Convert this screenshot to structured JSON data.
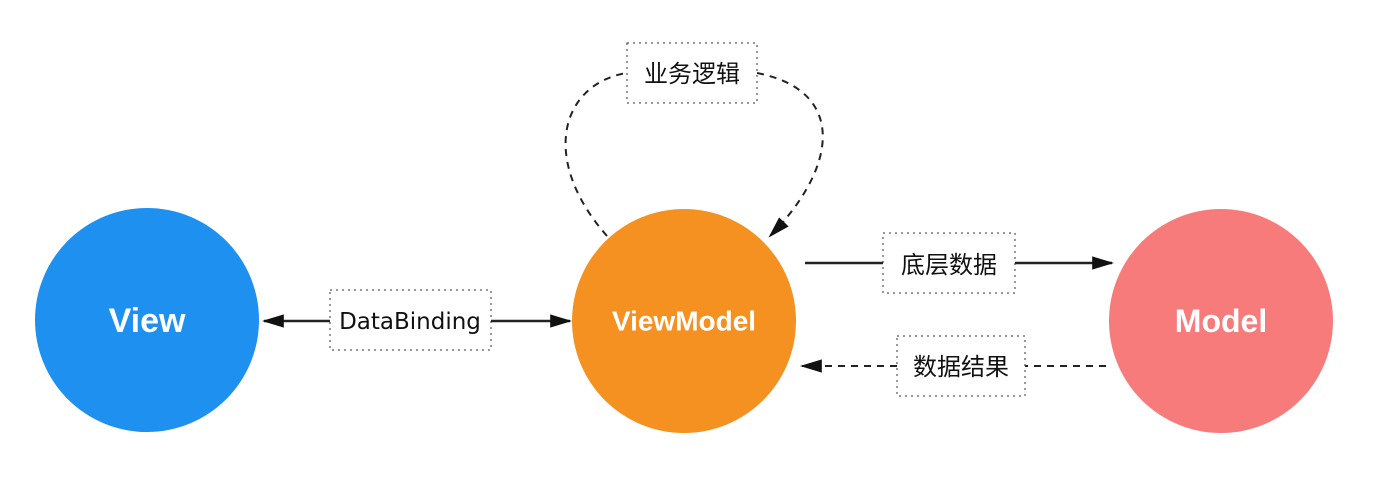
{
  "nodes": {
    "view": {
      "label": "View",
      "color": "#1e90f0"
    },
    "viewmodel": {
      "label": "ViewModel",
      "color": "#f59120"
    },
    "model": {
      "label": "Model",
      "color": "#f77b7b"
    }
  },
  "edges": {
    "databinding": {
      "label": "DataBinding"
    },
    "business_logic": {
      "label": "业务逻辑"
    },
    "underlying_data": {
      "label": "底层数据"
    },
    "data_result": {
      "label": "数据结果"
    }
  }
}
